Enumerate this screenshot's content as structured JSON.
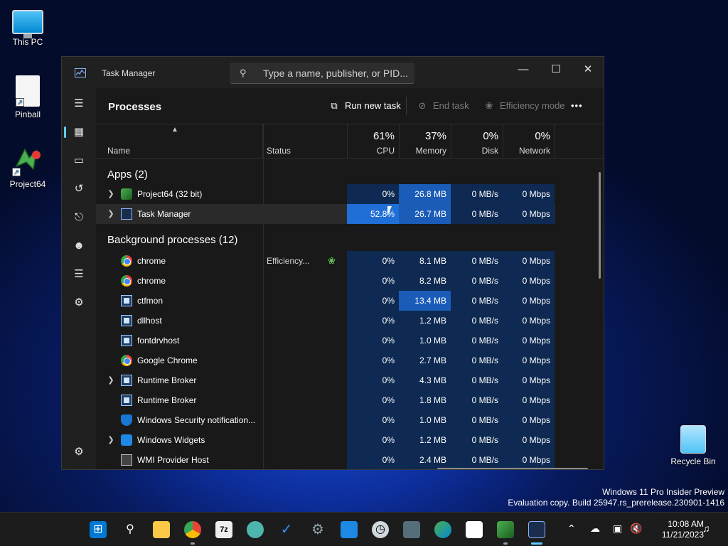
{
  "desktop": {
    "icons": [
      {
        "label": "This PC",
        "icon": "this-pc-icon"
      },
      {
        "label": "Pinball",
        "icon": "file-icon"
      },
      {
        "label": "Project64",
        "icon": "project64-icon"
      },
      {
        "label": "Recycle Bin",
        "icon": "recycle-bin-icon"
      }
    ],
    "watermark_line1": "Windows 11 Pro Insider Preview",
    "watermark_line2": "Evaluation copy. Build 25947.rs_prerelease.230901-1416"
  },
  "window": {
    "title": "Task Manager",
    "search_placeholder": "Type a name, publisher, or PID...",
    "controls": {
      "minimize": "—",
      "maximize": "☐",
      "close": "✕"
    }
  },
  "toolbar": {
    "page_title": "Processes",
    "run_new_task": "Run new task",
    "end_task": "End task",
    "efficiency_mode": "Efficiency mode",
    "more": "•••"
  },
  "columns": {
    "name": "Name",
    "status": "Status",
    "cpu": {
      "label": "CPU",
      "pct": "61%"
    },
    "memory": {
      "label": "Memory",
      "pct": "37%"
    },
    "disk": {
      "label": "Disk",
      "pct": "0%"
    },
    "network": {
      "label": "Network",
      "pct": "0%"
    }
  },
  "groups": {
    "apps": "Apps (2)",
    "background": "Background processes (12)"
  },
  "apps": [
    {
      "name": "Project64 (32 bit)",
      "icon": "project64-icon",
      "expandable": true,
      "status": "",
      "cpu": "0%",
      "mem": "26.8 MB",
      "disk": "0 MB/s",
      "net": "0 Mbps"
    },
    {
      "name": "Task Manager",
      "icon": "task-manager-icon",
      "expandable": true,
      "status": "",
      "cpu": "52.8%",
      "mem": "26.7 MB",
      "disk": "0 MB/s",
      "net": "0 Mbps"
    }
  ],
  "background": [
    {
      "name": "chrome",
      "icon": "chrome-icon",
      "expandable": false,
      "status": "Efficiency...",
      "cpu": "0%",
      "mem": "8.1 MB",
      "disk": "0 MB/s",
      "net": "0 Mbps"
    },
    {
      "name": "chrome",
      "icon": "chrome-icon",
      "expandable": false,
      "status": "",
      "cpu": "0%",
      "mem": "8.2 MB",
      "disk": "0 MB/s",
      "net": "0 Mbps"
    },
    {
      "name": "ctfmon",
      "icon": "window-icon",
      "expandable": false,
      "status": "",
      "cpu": "0%",
      "mem": "13.4 MB",
      "disk": "0 MB/s",
      "net": "0 Mbps"
    },
    {
      "name": "dllhost",
      "icon": "window-icon",
      "expandable": false,
      "status": "",
      "cpu": "0%",
      "mem": "1.2 MB",
      "disk": "0 MB/s",
      "net": "0 Mbps"
    },
    {
      "name": "fontdrvhost",
      "icon": "window-icon",
      "expandable": false,
      "status": "",
      "cpu": "0%",
      "mem": "1.0 MB",
      "disk": "0 MB/s",
      "net": "0 Mbps"
    },
    {
      "name": "Google Chrome",
      "icon": "chrome-icon",
      "expandable": false,
      "status": "",
      "cpu": "0%",
      "mem": "2.7 MB",
      "disk": "0 MB/s",
      "net": "0 Mbps"
    },
    {
      "name": "Runtime Broker",
      "icon": "window-icon",
      "expandable": true,
      "status": "",
      "cpu": "0%",
      "mem": "4.3 MB",
      "disk": "0 MB/s",
      "net": "0 Mbps"
    },
    {
      "name": "Runtime Broker",
      "icon": "window-icon",
      "expandable": false,
      "status": "",
      "cpu": "0%",
      "mem": "1.8 MB",
      "disk": "0 MB/s",
      "net": "0 Mbps"
    },
    {
      "name": "Windows Security notification...",
      "icon": "shield-icon",
      "expandable": false,
      "status": "",
      "cpu": "0%",
      "mem": "1.0 MB",
      "disk": "0 MB/s",
      "net": "0 Mbps"
    },
    {
      "name": "Windows Widgets",
      "icon": "widgets-icon",
      "expandable": true,
      "status": "",
      "cpu": "0%",
      "mem": "1.2 MB",
      "disk": "0 MB/s",
      "net": "0 Mbps"
    },
    {
      "name": "WMI Provider Host",
      "icon": "wmi-icon",
      "expandable": false,
      "status": "",
      "cpu": "0%",
      "mem": "2.4 MB",
      "disk": "0 MB/s",
      "net": "0 Mbps"
    }
  ],
  "colors": {
    "cell_light": "#0e2a52",
    "cell_mid": "#123a6e",
    "cell_high": "#1a5cb8",
    "cell_peak": "#1f6fd6",
    "accent": "#60cdff"
  },
  "sidebar_icons": [
    "hamburger-icon",
    "processes-icon",
    "performance-icon",
    "app-history-icon",
    "startup-apps-icon",
    "users-icon",
    "details-icon",
    "services-icon",
    "settings-icon"
  ],
  "taskbar": {
    "apps": [
      "start-icon",
      "search-icon",
      "file-explorer-icon",
      "chrome-icon",
      "7zip-icon",
      "paint-icon",
      "todo-icon",
      "settings-icon",
      "photos-icon",
      "clock-icon",
      "calculator-icon",
      "edge-icon",
      "store-icon",
      "project64-icon",
      "task-manager-icon"
    ],
    "zip_label": "7z",
    "time": "10:08 AM",
    "date": "11/21/2023"
  }
}
